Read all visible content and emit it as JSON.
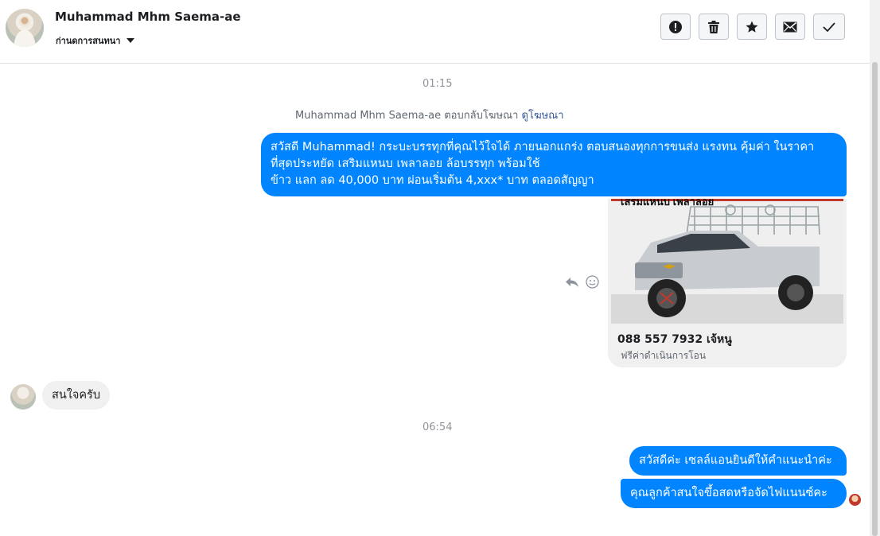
{
  "header": {
    "contact_name": "Muhammad Mhm Saema-ae",
    "manage_label": "ก่านดการสนทนา",
    "toolbar": [
      {
        "name": "report-button",
        "icon": "exclamation-icon"
      },
      {
        "name": "delete-button",
        "icon": "trash-icon"
      },
      {
        "name": "star-button",
        "icon": "star-icon"
      },
      {
        "name": "mark-unread-button",
        "icon": "envelope-icon"
      },
      {
        "name": "mark-done-button",
        "icon": "checkmark-icon"
      }
    ]
  },
  "conversation": {
    "time_1": "01:15",
    "ad_note": {
      "text": "Muhammad Mhm Saema-ae ตอบกลับโฆษณา ",
      "link": "ดูโฆษณา"
    },
    "ad_message": {
      "lines": [
        "สวัสดี Muhammad! กระบะบรรทุกที่คุณไว้ใจได้ ภายนอกแกร่ง ตอบสนองทุกการขนส่ง แรงทน คุ้มค่า ในราคา",
        "ที่สุดประหยัด เสริมแหนบ เพลาลอย ล้อบรรทุก พร้อมใช้",
        "ข้าว แลก ลด 40,000 บาท ผ่อนเริ่มต้น 4,xxx* บาท ตลอดสัญญา"
      ]
    },
    "ad_card": {
      "image_caption": "เสริมแหนบ เพลาลอย",
      "title": "088 557 7932 เจ้หนู",
      "subtitle": "ฟรีค่าดำเนินการโอน"
    },
    "incoming_message": "สนใจครับ",
    "time_2": "06:54",
    "reply_1": "สวัสดีค่ะ เซลล์แอนยินดีให้คำแนะนำค่ะ",
    "reply_2": "คุณลูกค้าสนใจขึ้อสดหรือจัดไฟแนนซ์คะ"
  },
  "colors": {
    "outgoing_bubble": "#0084ff",
    "incoming_bubble": "#f1f0f0",
    "link": "#365899"
  }
}
